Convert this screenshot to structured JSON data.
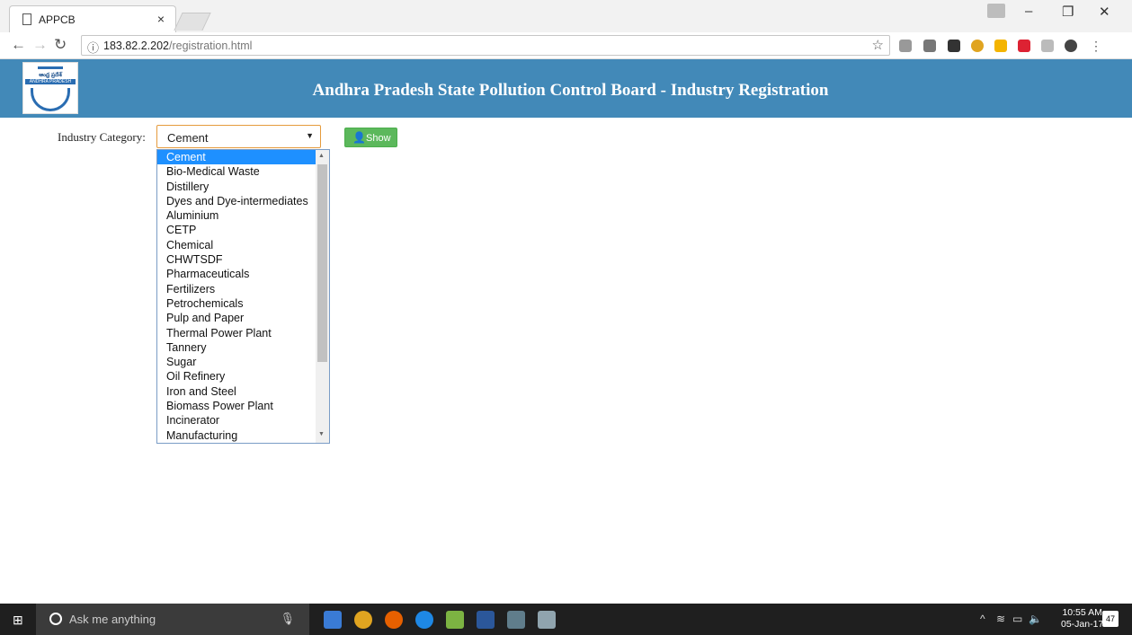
{
  "browser": {
    "tab_title": "APPCB",
    "url_host": "183.82.2.202",
    "url_path": "/registration.html"
  },
  "header": {
    "logo_text_top": "ఆంధ్ర ప్రదేశ్",
    "logo_text_bottom": "ANDHRA PRADESH",
    "title": "Andhra Pradesh State Pollution Control Board - Industry Registration"
  },
  "form": {
    "category_label": "Industry Category:",
    "selected_value": "Cement",
    "show_button": "Show",
    "options": [
      "Cement",
      "Bio-Medical Waste",
      "Distillery",
      "Dyes and Dye-intermediates",
      "Aluminium",
      "CETP",
      "Chemical",
      "CHWTSDF",
      "Pharmaceuticals",
      "Fertilizers",
      "Petrochemicals",
      "Pulp and Paper",
      "Thermal Power Plant",
      "Tannery",
      "Sugar",
      "Oil Refinery",
      "Iron and Steel",
      "Biomass Power Plant",
      "Incinerator",
      "Manufacturing"
    ]
  },
  "taskbar": {
    "search_placeholder": "Ask me anything",
    "time": "10:55 AM",
    "date": "05-Jan-17",
    "notification_count": "47"
  },
  "colors": {
    "header": "#4289b8",
    "show_button": "#5cb85c",
    "selected_option": "#1e90ff"
  }
}
